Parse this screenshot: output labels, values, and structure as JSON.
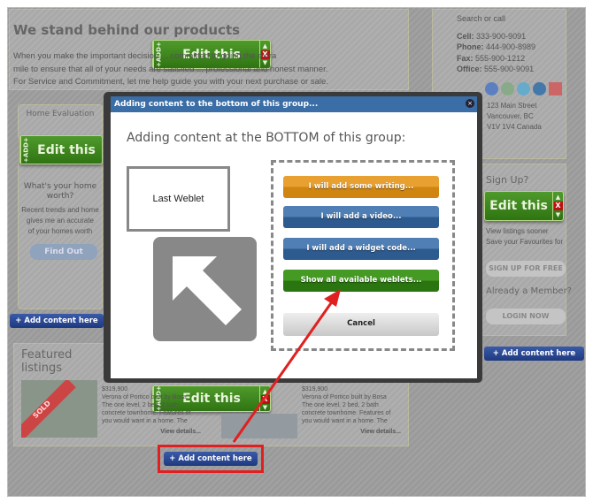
{
  "page": {
    "heading": "We stand behind our products",
    "paragraph": [
      "When you make the important decision ... committed to going the extra",
      "mile to ensure that all of your needs are satisfied ... professional and honest manner.",
      "For Service and Commitment, let me help guide you with your next purchase or sale."
    ],
    "home_eval": {
      "title": "Home Evaluation",
      "question": "What's your home worth?",
      "text": [
        "Recent trends and home",
        "gives me an accurate",
        "of your homes worth"
      ],
      "button": "Find Out"
    },
    "featured": {
      "title": "Featured listings",
      "sold": "SOLD",
      "items": [
        {
          "price": "$319,900",
          "desc": [
            "Verona of Portico built by Bosa",
            "The one level, 2 bed, 2 bath",
            "concrete townhome. Features of",
            "you would want in a home. The"
          ],
          "link": "View details..."
        },
        {
          "price": "$319,900",
          "desc": [
            "Verona of Portico built by Bosa",
            "The one level, 2 bed, 2 bath",
            "concrete townhome. Features of",
            "you would want in a home. The"
          ],
          "link": "View details..."
        }
      ]
    },
    "add_content": "+ Add content here",
    "edit_label": "Edit this",
    "add_tab": "+ADD+",
    "x_label": "X"
  },
  "sidebar": {
    "search": "Search or call",
    "contacts": [
      {
        "k": "Cell:",
        "v": "333-900-9091"
      },
      {
        "k": "Phone:",
        "v": "444-900-8989"
      },
      {
        "k": "Fax:",
        "v": "555-900-1212"
      },
      {
        "k": "Office:",
        "v": "555-900-9091"
      }
    ],
    "social": [
      "facebook",
      "flickr",
      "twitter",
      "linkedin",
      "youtube"
    ],
    "address": [
      "123 Main Street",
      "Vancouver, BC",
      "V1V 1V4 Canada"
    ],
    "signup_title": "Sign Up?",
    "signup_text": [
      "View listings sooner",
      "Save your Favourites for"
    ],
    "signup_btn": "SIGN UP FOR FREE",
    "member_title": "Already a Member?",
    "login_btn": "LOGIN NOW"
  },
  "modal": {
    "title": "Adding content to the bottom of this group...",
    "heading": "Adding content at the BOTTOM of this group:",
    "last_weblet": "Last Weblet",
    "buttons": [
      "I will add some writing...",
      "I will add a video...",
      "I will add a widget code...",
      "Show all available weblets..."
    ],
    "cancel": "Cancel"
  },
  "colors": {
    "modal_title": "#3b6ea6",
    "writing": "#d98b12",
    "video": "#2d5a8f",
    "weblets": "#2f7a12",
    "annotation": "#e02020"
  }
}
